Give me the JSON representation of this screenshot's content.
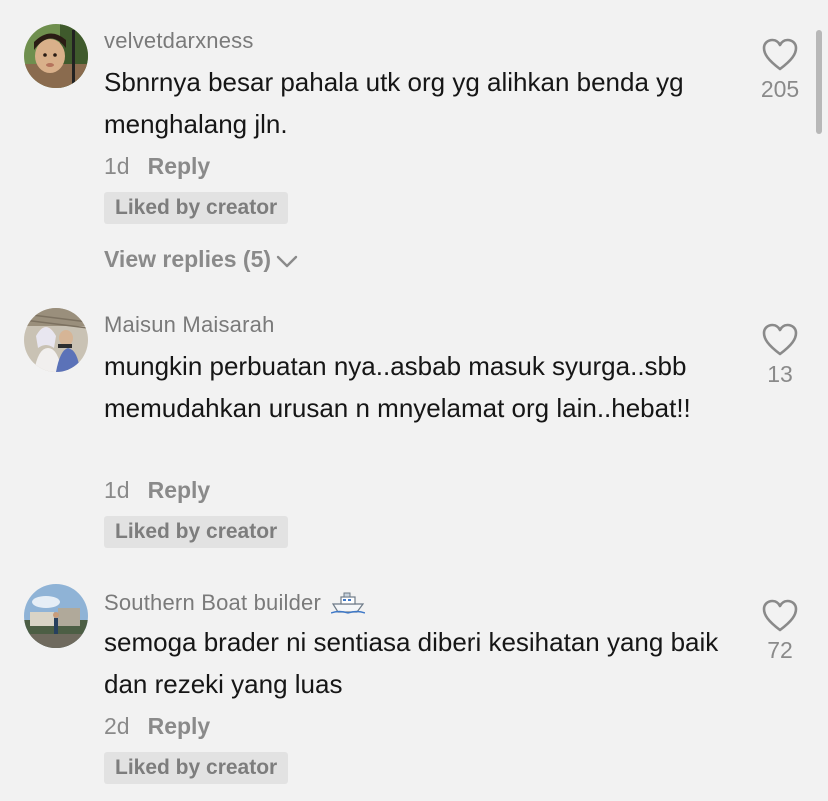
{
  "comments": [
    {
      "username": "velvetdarxness",
      "text": "Sbnrnya besar pahala utk org yg alihkan benda yg menghalang jln.",
      "age": "1d",
      "reply_label": "Reply",
      "badge": "Liked by creator",
      "view_replies": "View replies (5)",
      "likes": "205"
    },
    {
      "username": "Maisun Maisarah",
      "text": "mungkin perbuatan nya..asbab masuk syurga..sbb memudahkan urusan n mnyelamat org lain..hebat!!",
      "age": "1d",
      "reply_label": "Reply",
      "badge": "Liked by creator",
      "likes": "13"
    },
    {
      "username": "Southern Boat builder",
      "username_emoji": "boat-emoji",
      "text": "semoga brader ni sentiasa diberi kesihatan yang baik dan rezeki yang luas",
      "age": "2d",
      "reply_label": "Reply",
      "badge": "Liked by creator",
      "likes": "72"
    }
  ],
  "icons": {
    "like": "heart-outline-icon",
    "expand": "chevron-down-icon"
  },
  "colors": {
    "background": "#f2f2f2",
    "text_primary": "#161616",
    "text_secondary": "#8a8a8a",
    "badge_background": "#e2e2e2"
  }
}
